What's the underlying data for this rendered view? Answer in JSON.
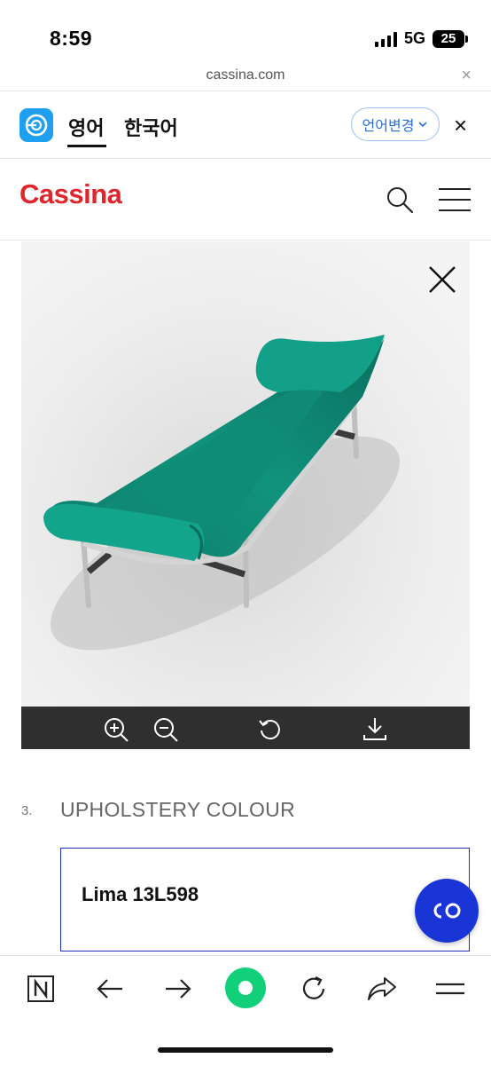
{
  "status": {
    "time": "8:59",
    "network": "5G",
    "battery": "25"
  },
  "browser": {
    "url": "cassina.com",
    "close_label": "×"
  },
  "translate": {
    "tab_source": "영어",
    "tab_target": "한국어",
    "change_language": "언어변경",
    "close_label": "×"
  },
  "site": {
    "brand": "Cassina",
    "icons": [
      "search-icon",
      "menu-icon"
    ]
  },
  "viewer": {
    "product_colors": {
      "upholstery": "#0e8a77",
      "frame": "#c9c9c9"
    },
    "toolbar_icons": [
      "zoom-in-icon",
      "zoom-out-icon",
      "rotate-icon",
      "download-icon"
    ]
  },
  "section": {
    "number": "3.",
    "title": "UPHOLSTERY COLOUR",
    "selected_colour": "Lima 13L598"
  },
  "bottom_nav": {
    "icons": [
      "notion-icon",
      "back-arrow-icon",
      "forward-arrow-icon",
      "home-dot-icon",
      "reload-icon",
      "share-icon",
      "menu-lines-icon"
    ]
  },
  "colors": {
    "brand": "#e0262d",
    "accent_blue": "#1a35d6",
    "toolbar": "#2f2f2f",
    "green_button": "#12d07a"
  }
}
